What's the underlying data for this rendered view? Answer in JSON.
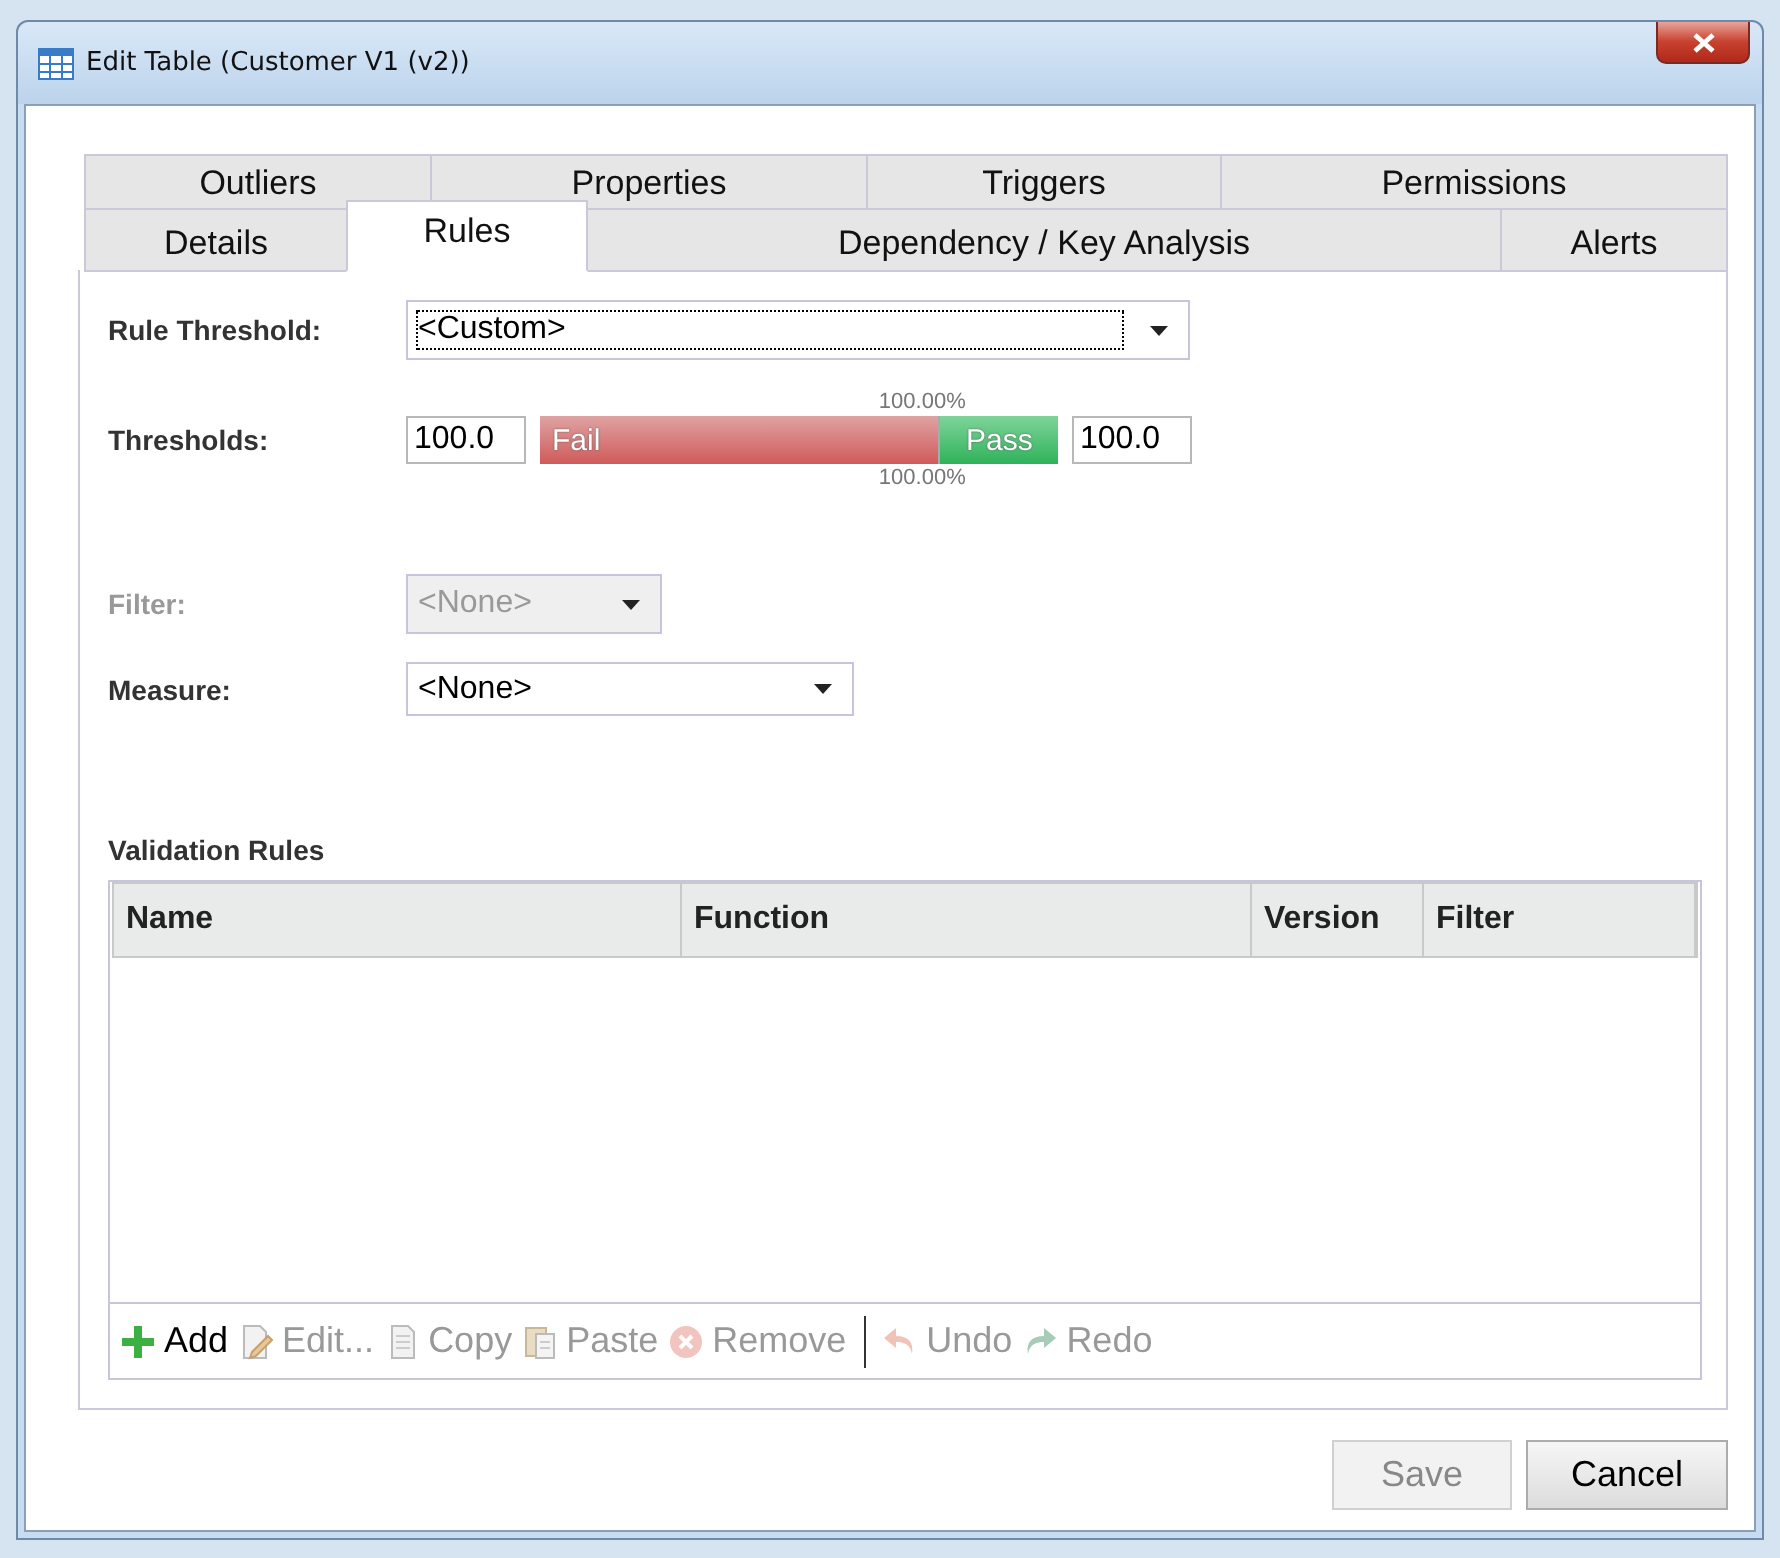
{
  "window": {
    "title": "Edit Table (Customer V1 (v2))"
  },
  "tabs": [
    [
      {
        "label": "Outliers",
        "selected": false
      },
      {
        "label": "Properties",
        "selected": false
      },
      {
        "label": "Triggers",
        "selected": false
      },
      {
        "label": "Permissions",
        "selected": false
      }
    ],
    [
      {
        "label": "Details",
        "selected": false
      },
      {
        "label": "Rules",
        "selected": true
      },
      {
        "label": "Dependency / Key Analysis",
        "selected": false
      },
      {
        "label": "Alerts",
        "selected": false
      }
    ]
  ],
  "rule_threshold": {
    "label": "Rule Threshold:",
    "value": "<Custom>",
    "focused": true
  },
  "thresholds": {
    "label": "Thresholds:",
    "low_value": "100.0",
    "high_value": "100.0",
    "fail_label": "Fail",
    "pass_label": "Pass",
    "upper_percent": "100.00%",
    "lower_percent": "100.00%",
    "level": 0.77
  },
  "filter": {
    "label": "Filter:",
    "value": "<None>",
    "disabled": true
  },
  "measure": {
    "label": "Measure:",
    "value": "<None>",
    "disabled": false
  },
  "validation_rules": {
    "title": "Validation Rules",
    "columns": [
      "Name",
      "Function",
      "Version",
      "Filter"
    ],
    "toolbar": [
      {
        "kind": "add",
        "label": "Add",
        "disabled": false
      },
      {
        "kind": "edit",
        "label": "Edit...",
        "disabled": true
      },
      {
        "kind": "copy",
        "label": "Copy",
        "disabled": true
      },
      {
        "kind": "paste",
        "label": "Paste",
        "disabled": true
      },
      {
        "kind": "remove",
        "label": "Remove",
        "disabled": true
      },
      {
        "kind": "separator"
      },
      {
        "kind": "undo",
        "label": "Undo",
        "disabled": true
      },
      {
        "kind": "redo",
        "label": "Redo",
        "disabled": true
      }
    ]
  },
  "buttons": [
    {
      "label": "Save",
      "disabled": true
    },
    {
      "label": "Cancel",
      "disabled": false
    }
  ]
}
